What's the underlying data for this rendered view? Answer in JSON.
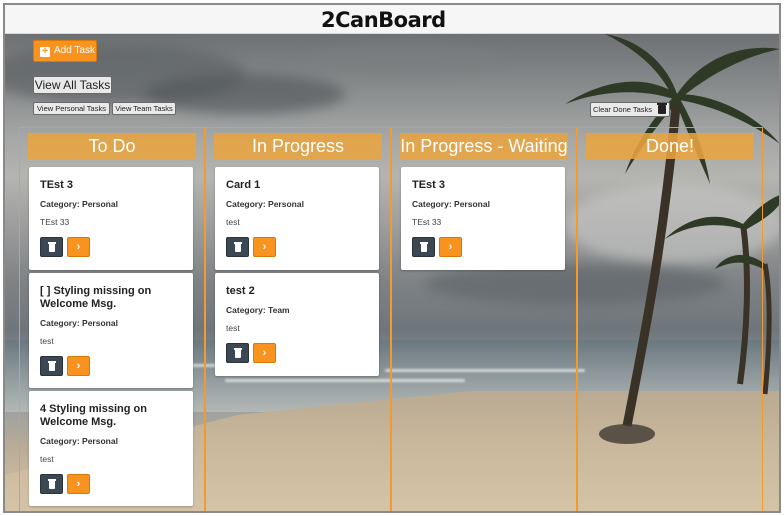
{
  "header": {
    "logo": "2CanBoard"
  },
  "toolbar": {
    "add_task": "Add Task",
    "view_all": "View All Tasks",
    "view_personal": "View Personal Tasks",
    "view_team": "View Team Tasks",
    "clear_done": "Clear Done Tasks"
  },
  "columns": [
    {
      "title": "To Do",
      "cards": [
        {
          "title": "TEst 3",
          "category": "Category: Personal",
          "description": "TEst 33"
        },
        {
          "title": "[ ] Styling missing on Welcome Msg.",
          "category": "Category: Personal",
          "description": "test"
        },
        {
          "title": "4 Styling missing on Welcome Msg.",
          "category": "Category: Personal",
          "description": "test"
        }
      ]
    },
    {
      "title": "In Progress",
      "cards": [
        {
          "title": "Card 1",
          "category": "Category: Personal",
          "description": "test"
        },
        {
          "title": "test 2",
          "category": "Category: Team",
          "description": "test"
        }
      ]
    },
    {
      "title": "In Progress - Waiting",
      "cards": [
        {
          "title": "TEst 3",
          "category": "Category: Personal",
          "description": "TEst 33"
        }
      ]
    },
    {
      "title": "Done!",
      "cards": []
    }
  ],
  "icons": {
    "delete": "trash-icon",
    "advance": "chevron-right-icon",
    "add": "plus-icon"
  },
  "colors": {
    "accent": "#f7931e",
    "column_header": "#e8a440",
    "delete_button": "#3b4752"
  }
}
